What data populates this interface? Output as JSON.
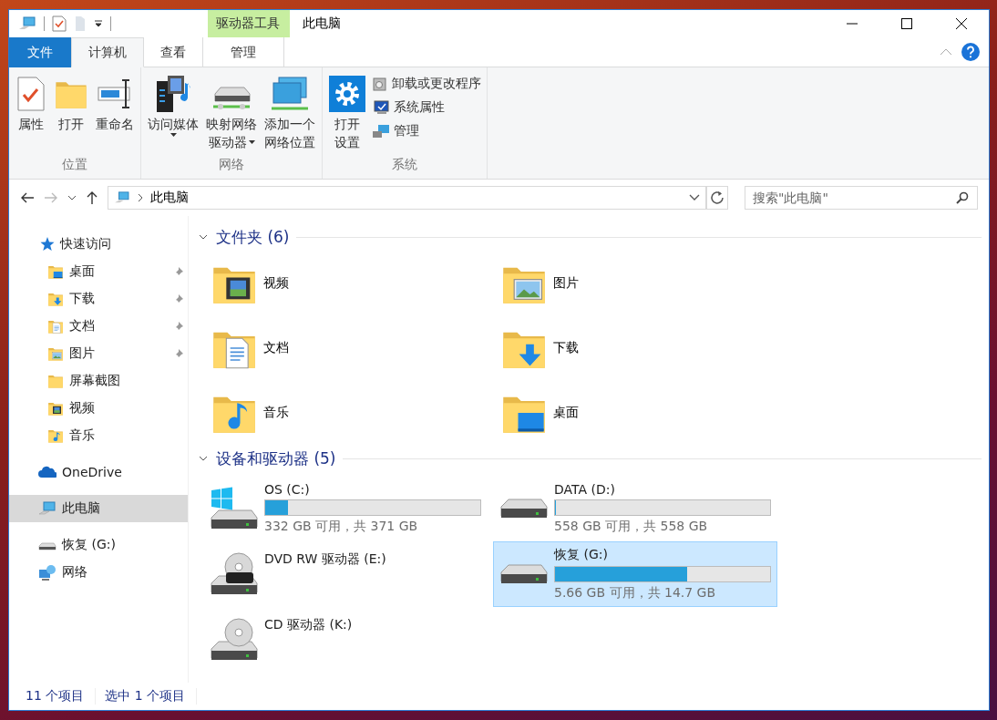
{
  "title_bar": {
    "context_group": "驱动器工具",
    "title": "此电脑"
  },
  "ribbon_tabs": [
    {
      "label": "文件",
      "kind": "file",
      "selected": false
    },
    {
      "label": "计算机",
      "kind": "normal",
      "selected": true
    },
    {
      "label": "查看",
      "kind": "normal",
      "selected": false
    },
    {
      "label": "管理",
      "kind": "context",
      "selected": false
    }
  ],
  "ribbon_groups": [
    {
      "label": "位置",
      "buttons": [
        {
          "lines": [
            "属性"
          ],
          "has_menu": false
        },
        {
          "lines": [
            "打开"
          ],
          "has_menu": false
        },
        {
          "lines": [
            "重命名"
          ],
          "has_menu": false
        }
      ]
    },
    {
      "label": "网络",
      "buttons": [
        {
          "lines": [
            "访问媒体"
          ],
          "has_menu": true
        },
        {
          "lines": [
            "映射网络",
            "驱动器"
          ],
          "has_menu": true
        },
        {
          "lines": [
            "添加一个",
            "网络位置"
          ],
          "has_menu": false
        }
      ]
    },
    {
      "label": "系统",
      "buttons": [
        {
          "lines": [
            "打开",
            "设置"
          ],
          "has_menu": false
        }
      ],
      "small_buttons": [
        {
          "label": "卸载或更改程序"
        },
        {
          "label": "系统属性"
        },
        {
          "label": "管理"
        }
      ]
    }
  ],
  "address_bar": {
    "path": "此电脑",
    "search_placeholder": "搜索\"此电脑\""
  },
  "nav_pane": [
    {
      "label": "快速访问",
      "kind": "star",
      "selected": false,
      "children": [
        {
          "label": "桌面",
          "kind": "desktop",
          "pinned": true,
          "selected": false
        },
        {
          "label": "下载",
          "kind": "downloads",
          "pinned": true,
          "selected": false
        },
        {
          "label": "文档",
          "kind": "documents",
          "pinned": true,
          "selected": false
        },
        {
          "label": "图片",
          "kind": "pictures",
          "pinned": true,
          "selected": false
        },
        {
          "label": "屏幕截图",
          "kind": "plain",
          "pinned": false,
          "selected": false
        },
        {
          "label": "视频",
          "kind": "videos",
          "pinned": false,
          "selected": false
        },
        {
          "label": "音乐",
          "kind": "music",
          "pinned": false,
          "selected": false
        }
      ]
    },
    {
      "label": "OneDrive",
      "kind": "cloud",
      "selected": false
    },
    {
      "label": "此电脑",
      "kind": "pc",
      "selected": true
    },
    {
      "label": "恢复 (G:)",
      "kind": "drive",
      "selected": false
    },
    {
      "label": "网络",
      "kind": "network",
      "selected": false
    }
  ],
  "folders": {
    "title": "文件夹 (6)",
    "expanded": true,
    "items": [
      {
        "name": "视频",
        "kind": "videos"
      },
      {
        "name": "图片",
        "kind": "pictures"
      },
      {
        "name": "文档",
        "kind": "documents"
      },
      {
        "name": "下载",
        "kind": "downloads"
      },
      {
        "name": "音乐",
        "kind": "music"
      },
      {
        "name": "桌面",
        "kind": "desktop"
      }
    ]
  },
  "drives": {
    "title": "设备和驱动器 (5)",
    "expanded": true,
    "items": [
      {
        "name": "OS (C:)",
        "kind": "windows",
        "level": 0.105,
        "reading": "332 GB 可用，共 371 GB",
        "selected": false
      },
      {
        "name": "DATA (D:)",
        "kind": "hdd",
        "level": 0.002,
        "reading": "558 GB 可用，共 558 GB",
        "selected": false
      },
      {
        "name": "DVD RW 驱动器 (E:)",
        "kind": "dvd",
        "selected": false
      },
      {
        "name": "恢复 (G:)",
        "kind": "hdd",
        "level": 0.615,
        "reading": "5.66 GB 可用，共 14.7 GB",
        "selected": true
      },
      {
        "name": "CD 驱动器 (K:)",
        "kind": "cd",
        "selected": false
      }
    ]
  },
  "status_bar": [
    "11 个项目",
    "选中 1 个项目"
  ]
}
